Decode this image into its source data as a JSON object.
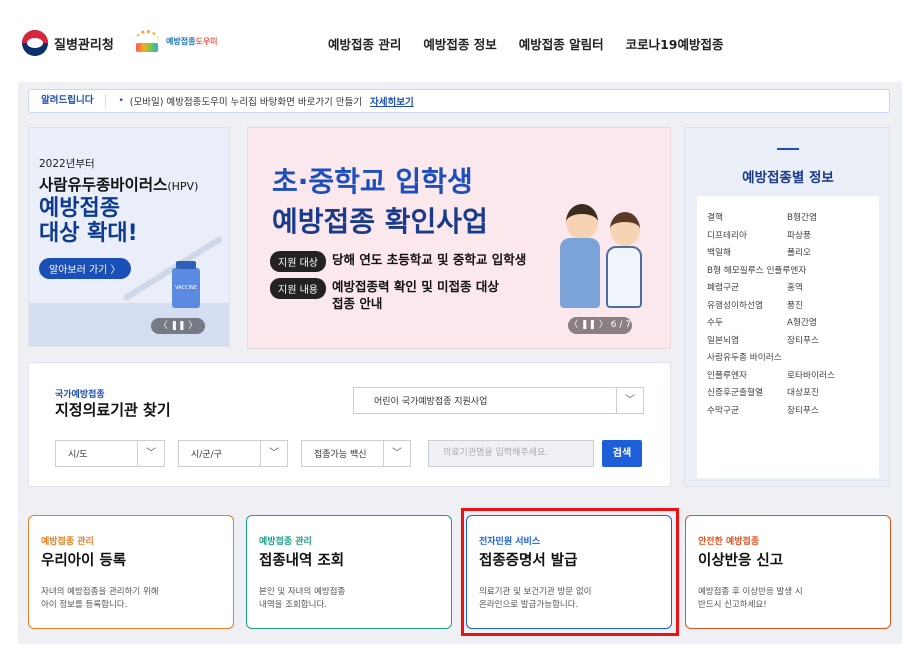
{
  "header": {
    "agency_name": "질병관리청",
    "helper_logo_a": "예방접종",
    "helper_logo_b": "도우미",
    "nav": [
      "예방접종 관리",
      "예방접종 정보",
      "예방접종 알림터",
      "코로나19예방접종"
    ]
  },
  "notice": {
    "label": "알려드립니다",
    "bullet": "•",
    "text": "(모바일) 예방접종도우미 누리집 바탕화면 바로가기 만들기",
    "more": "자세히보기"
  },
  "hpv_banner": {
    "since": "2022년부터",
    "line1_main": "사람유두종바이러스",
    "line1_small": "(HPV)",
    "line2": "예방접종",
    "line3": "대상 확대!",
    "button": "알아보러 가기 〉",
    "vial_label": "VACCINE",
    "pager": "〈  ❚❚  〉"
  },
  "school_banner": {
    "title1": "초·중학교 입학생",
    "title2": "예방접종 확인사업",
    "row1_tag": "지원 대상",
    "row1_value": "당해 연도 초등학교 및 중학교 입학생",
    "row2_tag": "지원 내용",
    "row2_value_a": "예방접종력 확인 및 미접종 대상",
    "row2_value_b": "접종 안내",
    "pager": "〈  ❚❚  〉 6 / 7"
  },
  "vaccine_info": {
    "title": "예방접종별 정보",
    "items": [
      [
        "결핵",
        "B형간염"
      ],
      [
        "디프테리아",
        "파상풍"
      ],
      [
        "백일해",
        "폴리오"
      ],
      [
        "B형 헤모필루스 인플루엔자",
        ""
      ],
      [
        "폐렴구균",
        "홍역"
      ],
      [
        "유행성이하선염",
        "풍진"
      ],
      [
        "수두",
        "A형간염"
      ],
      [
        "일본뇌염",
        "장티푸스"
      ],
      [
        "사람유두종 바이러스",
        ""
      ],
      [
        "인플루엔자",
        "로타바이러스"
      ],
      [
        "신증후군출혈열",
        "대상포진"
      ],
      [
        "수막구균",
        "장티푸스"
      ]
    ]
  },
  "clinic_finder": {
    "sub": "국가예방접종",
    "title": "지정의료기관 찾기",
    "program": "어린이 국가예방접종 지원사업",
    "province": "시/도",
    "city": "시/군/구",
    "vaccine": "접종가능 백신",
    "search_placeholder": "의료기관명을 입력해주세요.",
    "search_button": "검색",
    "caret": "﹀"
  },
  "services": [
    {
      "category": "예방접종 관리",
      "title": "우리아이 등록",
      "desc1": "자녀의 예방접종을 관리하기 위해",
      "desc2": "아이 정보를 등록합니다.",
      "color": "#e67e22"
    },
    {
      "category": "예방접종 관리",
      "title": "접종내역 조회",
      "desc1": "본인 및 자녀의 예방접종",
      "desc2": "내역을 조회합니다.",
      "color": "#1f9e86"
    },
    {
      "category": "전자민원 서비스",
      "title": "접종증명서 발급",
      "desc1": "의료기관 및 보건기관 방문 없이",
      "desc2": "온라인으로 발급가능합니다.",
      "color": "#1d5fd8"
    },
    {
      "category": "안전한 예방접종",
      "title": "이상반응 신고",
      "desc1": "예방접종 후 이상반응 발생 시",
      "desc2": "반드시 신고하세요!",
      "color": "#e0531f"
    }
  ]
}
